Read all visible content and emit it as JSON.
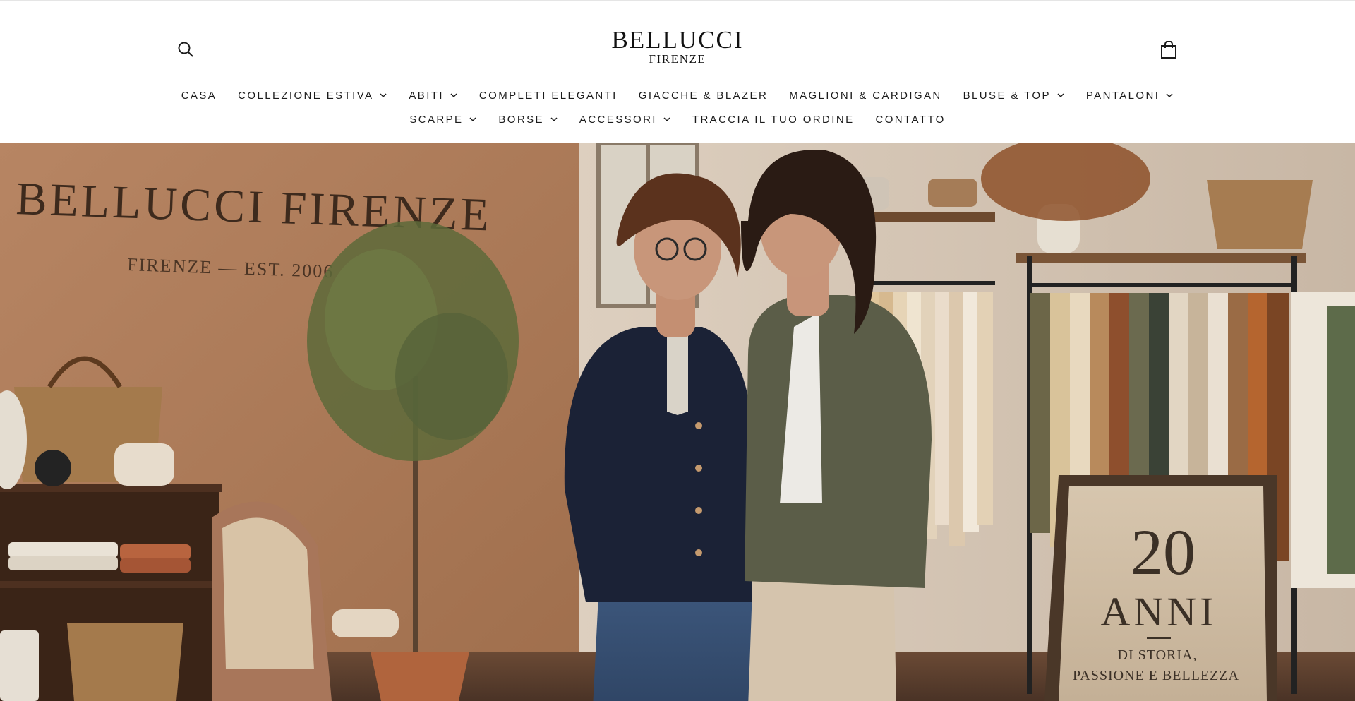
{
  "header": {
    "logo": {
      "brand": "BELLUCCI",
      "city": "FIRENZE"
    },
    "icons": {
      "search": "search-icon",
      "cart": "shopping-bag-icon"
    }
  },
  "nav": {
    "row1": [
      {
        "label": "CASA",
        "dropdown": false
      },
      {
        "label": "COLLEZIONE ESTIVA",
        "dropdown": true
      },
      {
        "label": "ABITI",
        "dropdown": true
      },
      {
        "label": "COMPLETI ELEGANTI",
        "dropdown": false
      },
      {
        "label": "GIACCHE & BLAZER",
        "dropdown": false
      },
      {
        "label": "MAGLIONI & CARDIGAN",
        "dropdown": false
      },
      {
        "label": "BLUSE & TOP",
        "dropdown": true
      },
      {
        "label": "PANTALONI",
        "dropdown": true
      }
    ],
    "row2": [
      {
        "label": "SCARPE",
        "dropdown": true
      },
      {
        "label": "BORSE",
        "dropdown": true
      },
      {
        "label": "ACCESSORI",
        "dropdown": true
      },
      {
        "label": "TRACCIA IL TUO ORDINE",
        "dropdown": false
      },
      {
        "label": "CONTATTO",
        "dropdown": false
      }
    ]
  },
  "hero": {
    "wall_sign": {
      "title": "BELLUCCI FIRENZE",
      "subtitle": "FIRENZE — EST. 2006"
    },
    "easel_sign": {
      "number": "20",
      "word": "ANNI",
      "line1": "DI STORIA,",
      "line2": "PASSIONE E BELLEZZA"
    }
  },
  "colors": {
    "wall": "#b98663",
    "navy": "#1b2236",
    "olive": "#5b5d48",
    "text": "#1b1b1b"
  }
}
